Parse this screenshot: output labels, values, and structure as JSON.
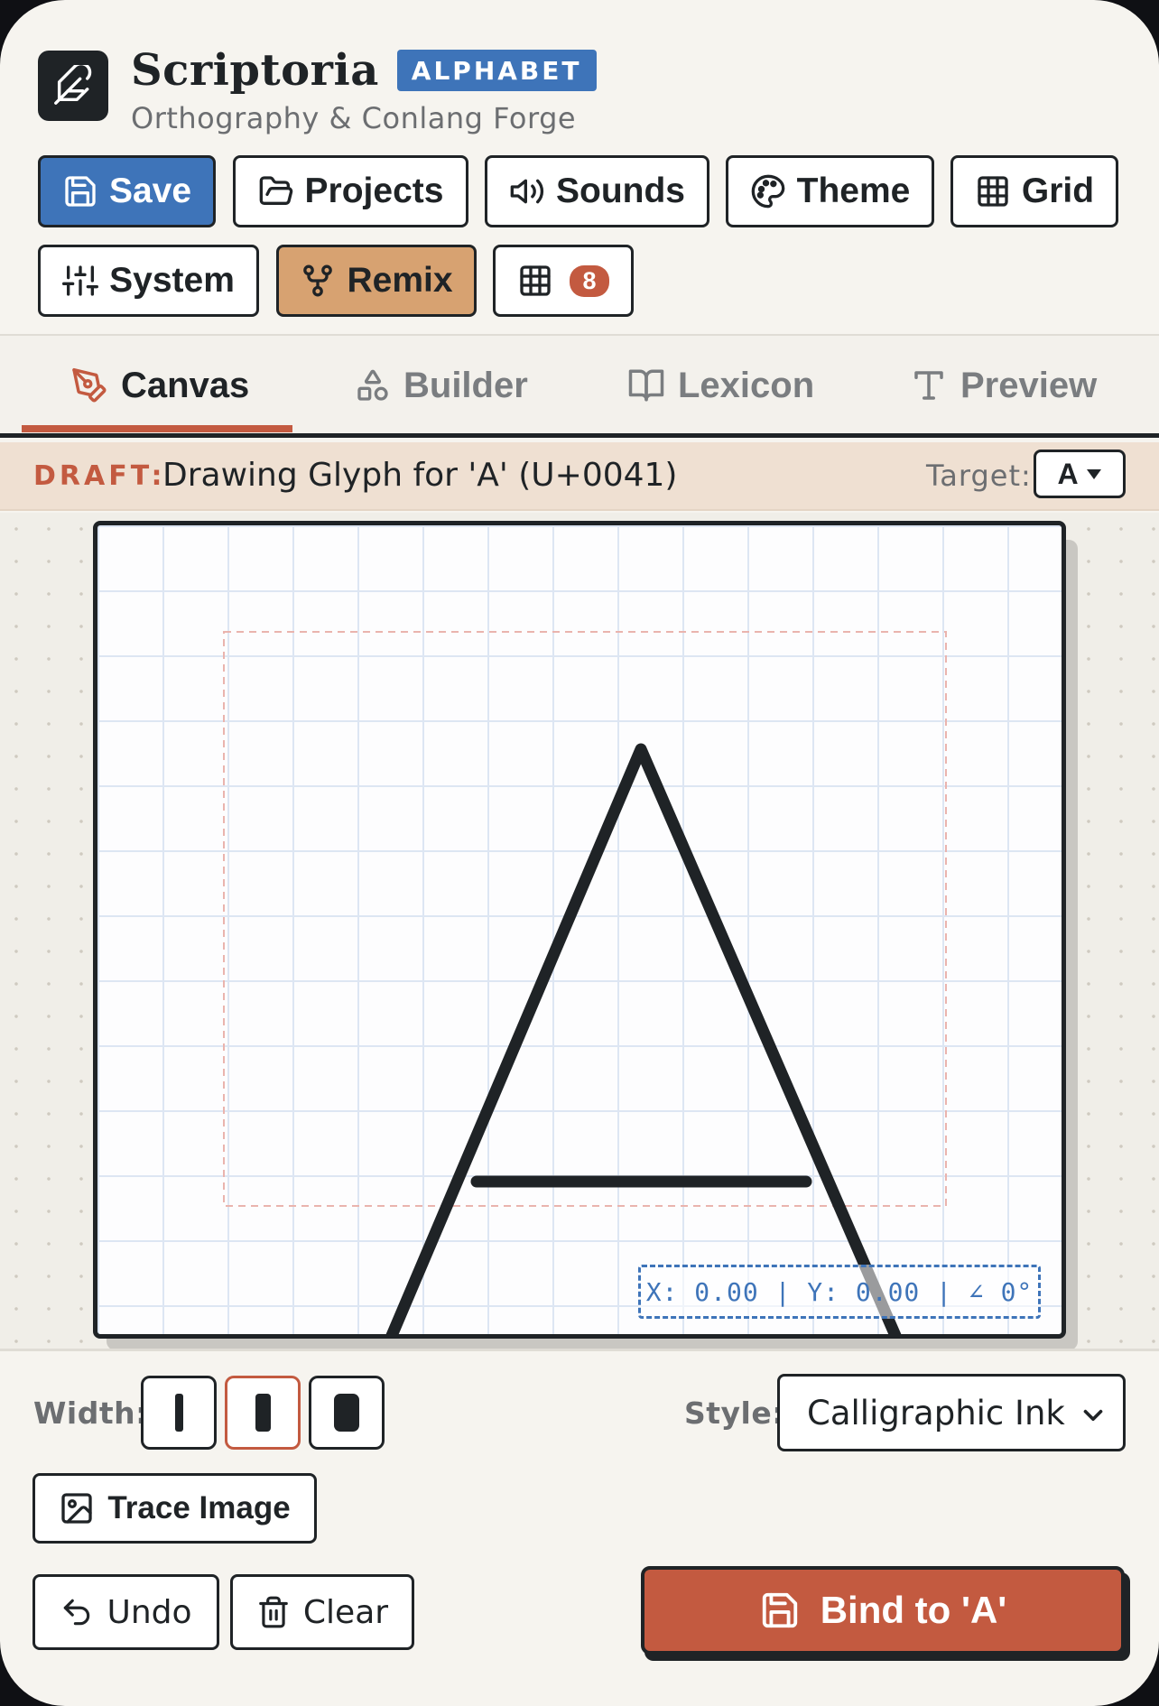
{
  "app": {
    "name": "Scriptoria",
    "badge": "ALPHABET",
    "subtitle": "Orthography & Conlang Forge"
  },
  "toolbar": {
    "save": "Save",
    "projects": "Projects",
    "sounds": "Sounds",
    "theme": "Theme",
    "grid": "Grid",
    "system": "System",
    "remix": "Remix",
    "glyph_count": "8"
  },
  "tabs": [
    "Canvas",
    "Builder",
    "Lexicon",
    "Preview"
  ],
  "active_tab": "Canvas",
  "draft": {
    "tag": "DRAFT:",
    "text": "Drawing Glyph for 'A' (U+0041)",
    "target_label": "Target:",
    "target_value": "A"
  },
  "canvas": {
    "readout": "X: 0.00 | Y: 0.00 | ∠ 0°"
  },
  "controls": {
    "width_label": "Width:",
    "width_options": [
      "thin",
      "medium",
      "thick"
    ],
    "width_selected": "medium",
    "style_label": "Style:",
    "style_value": "Calligraphic Ink",
    "trace_image": "Trace Image",
    "undo": "Undo",
    "clear": "Clear",
    "bind": "Bind to 'A'"
  },
  "colors": {
    "primary": "#3e74b9",
    "accent": "#c35a40",
    "remix": "#d7a271",
    "ink": "#1f2326"
  },
  "icons": {
    "logo": "feather-icon",
    "save": "floppy-disk-icon",
    "projects": "folder-open-icon",
    "sounds": "speaker-icon",
    "theme": "palette-icon",
    "grid": "grid-icon",
    "system": "sliders-icon",
    "remix": "git-fork-icon",
    "canvas_tab": "pen-nib-icon",
    "builder_tab": "shapes-icon",
    "lexicon_tab": "book-icon",
    "preview_tab": "type-icon",
    "trace": "image-icon",
    "undo": "undo-icon",
    "clear": "trash-icon",
    "bind": "floppy-disk-icon"
  }
}
